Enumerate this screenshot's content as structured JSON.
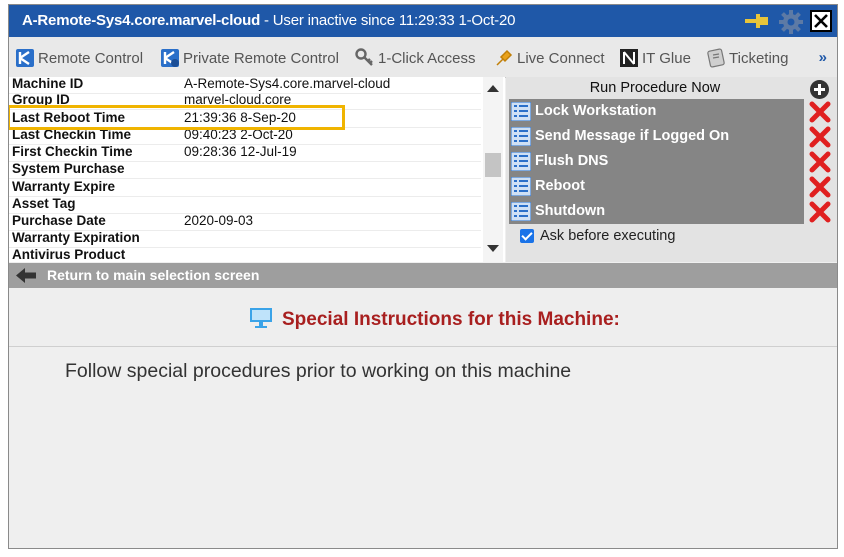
{
  "window": {
    "machine_name": "A-Remote-Sys4.core.marvel-cloud",
    "status": " - User inactive since 11:29:33 1-Oct-20"
  },
  "titlebar_icons": [
    "pin-icon",
    "gear-icon",
    "close-icon"
  ],
  "toolbar": {
    "items": [
      {
        "label": "Remote Control",
        "icon": "remote-control-icon"
      },
      {
        "label": "Private Remote Control",
        "icon": "private-remote-control-icon"
      },
      {
        "label": "1-Click Access",
        "icon": "key-icon"
      },
      {
        "label": "Live Connect",
        "icon": "live-connect-icon"
      },
      {
        "label": "IT Glue",
        "icon": "it-glue-icon"
      },
      {
        "label": "Ticketing",
        "icon": "ticketing-icon"
      }
    ],
    "more": "»"
  },
  "machine_info": {
    "rows": [
      {
        "label": "Machine ID",
        "value": "A-Remote-Sys4.core.marvel-cloud"
      },
      {
        "label": "Group ID",
        "value": "marvel-cloud.core"
      },
      {
        "label": "Last Reboot Time",
        "value": "21:39:36 8-Sep-20"
      },
      {
        "label": "Last Checkin Time",
        "value": "09:40:23 2-Oct-20"
      },
      {
        "label": "First Checkin Time",
        "value": "09:28:36 12-Jul-19"
      },
      {
        "label": "System Purchase",
        "value": ""
      },
      {
        "label": "Warranty Expire",
        "value": ""
      },
      {
        "label": "Asset Tag",
        "value": ""
      },
      {
        "label": "Purchase Date",
        "value": "2020-09-03"
      },
      {
        "label": "Warranty Expiration",
        "value": ""
      },
      {
        "label": "Antivirus Product",
        "value": ""
      }
    ],
    "highlighted_row": "Last Reboot Time"
  },
  "procedures": {
    "header": "Run Procedure Now",
    "items": [
      {
        "label": "Lock Workstation"
      },
      {
        "label": "Send Message if Logged On"
      },
      {
        "label": "Flush DNS"
      },
      {
        "label": "Reboot"
      },
      {
        "label": "Shutdown"
      }
    ],
    "ask_label": "Ask before executing",
    "ask_checked": true
  },
  "return_label": "Return to main selection screen",
  "special": {
    "title": "Special Instructions for this Machine:",
    "text": "Follow special procedures prior to working on this machine"
  },
  "colors": {
    "titlebar": "#1f58a8",
    "highlight": "#f0b400",
    "special_title": "#a81f1f",
    "delete": "#e02020"
  }
}
